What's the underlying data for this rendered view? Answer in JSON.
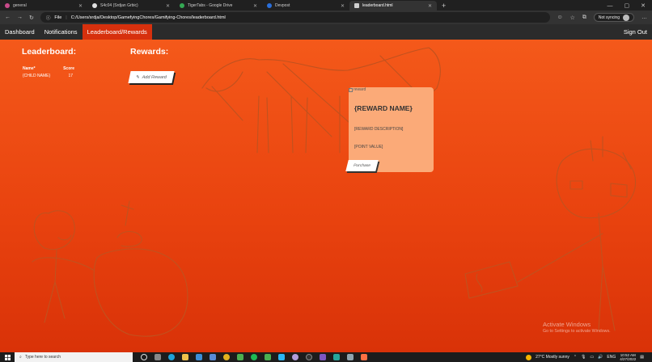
{
  "browser": {
    "tabs": [
      {
        "label": "general",
        "color": "#c94a8a",
        "active": false
      },
      {
        "label": "S4c04 (Srdjan Grbic)",
        "color": "#e0e0e0",
        "active": false
      },
      {
        "label": "TigerTabs - Google Drive",
        "color": "#34a853",
        "active": false
      },
      {
        "label": "Devpost",
        "color": "#2a6fdb",
        "active": false
      },
      {
        "label": "leaderboard.html",
        "color": "#cfcfcf",
        "active": true
      }
    ],
    "address_label": "File",
    "url": "C:/Users/srdja/Desktop/GamefyingChores/Gamifying-Chores/leaderboard.html",
    "sync_label": "Not syncing"
  },
  "nav": {
    "items": [
      "Dashboard",
      "Notifications",
      "Leaderboard/Rewards"
    ],
    "active": "Leaderboard/Rewards",
    "signout": "Sign Out"
  },
  "leaderboard": {
    "title": "Leaderboard:",
    "col_name": "Name*",
    "col_score": "Score",
    "rows": [
      {
        "name": "{CHILD NAME}",
        "score": "17"
      }
    ]
  },
  "rewards": {
    "title": "Rewards:",
    "add_label": "Add Reward",
    "card": {
      "img_alt": "reward",
      "name": "{REWARD NAME}",
      "description": "[REWARD DESCRIPTION]",
      "points": "[POINT VALUE]",
      "purchase_label": "Purchase"
    }
  },
  "watermark": {
    "title": "Activate Windows",
    "subtitle": "Go to Settings to activate Windows."
  },
  "taskbar": {
    "search_placeholder": "Type here to search",
    "weather": "27°C  Mostly sunny",
    "lang": "ENG",
    "time": "10:52 AM",
    "date": "4/27/2022"
  },
  "colors": {
    "accent": "#d7300d",
    "bg_top": "#f4591a",
    "bg_bottom": "#d93208",
    "card": "#fbaa78"
  }
}
